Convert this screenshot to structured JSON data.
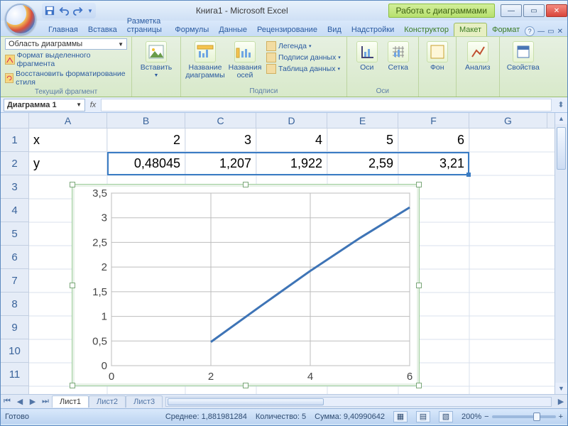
{
  "title": "Книга1 - Microsoft Excel",
  "chart_tools_label": "Работа с диаграммами",
  "tabs": {
    "main": [
      "Главная",
      "Вставка",
      "Разметка страницы",
      "Формулы",
      "Данные",
      "Рецензирование",
      "Вид",
      "Надстройки"
    ],
    "chart": [
      "Конструктор",
      "Макет",
      "Формат"
    ],
    "active": "Макет"
  },
  "ribbon": {
    "selector_value": "Область диаграммы",
    "format_selection": "Формат выделенного фрагмента",
    "reset_style": "Восстановить форматирование стиля",
    "selector_group": "Текущий фрагмент",
    "insert": "Вставить",
    "chart_title": "Название диаграммы",
    "axis_titles": "Названия осей",
    "legend": "Легенда",
    "data_labels": "Подписи данных",
    "data_table": "Таблица данных",
    "labels_group": "Подписи",
    "axes": "Оси",
    "grid": "Сетка",
    "axes_group": "Оси",
    "background": "Фон",
    "analysis": "Анализ",
    "properties": "Свойства"
  },
  "namebox": "Диаграмма 1",
  "fx_label": "fx",
  "columns": [
    "A",
    "B",
    "C",
    "D",
    "E",
    "F",
    "G"
  ],
  "rows": [
    "1",
    "2",
    "3",
    "4",
    "5",
    "6",
    "7",
    "8",
    "9",
    "10",
    "11"
  ],
  "cells": {
    "A1": "x",
    "B1": "2",
    "C1": "3",
    "D1": "4",
    "E1": "5",
    "F1": "6",
    "A2": "y",
    "B2": "0,48045",
    "C2": "1,207",
    "D2": "1,922",
    "E2": "2,59",
    "F2": "3,21"
  },
  "sheet_tabs": [
    "Лист1",
    "Лист2",
    "Лист3"
  ],
  "status": {
    "ready": "Готово",
    "avg_label": "Среднее:",
    "avg": "1,881981284",
    "count_label": "Количество:",
    "count": "5",
    "sum_label": "Сумма:",
    "sum": "9,40990642",
    "zoom": "200%"
  },
  "chart_data": {
    "type": "line",
    "x": [
      2,
      3,
      4,
      5,
      6
    ],
    "values": [
      0.48045,
      1.207,
      1.922,
      2.59,
      3.21
    ],
    "xlim": [
      0,
      6
    ],
    "ylim": [
      0,
      3.5
    ],
    "xticks": [
      0,
      2,
      4,
      6
    ],
    "yticks": [
      0,
      0.5,
      1,
      1.5,
      2,
      2.5,
      3,
      3.5
    ],
    "ytick_labels": [
      "0",
      "0,5",
      "1",
      "1,5",
      "2",
      "2,5",
      "3",
      "3,5"
    ],
    "title": "",
    "xlabel": "",
    "ylabel": ""
  }
}
